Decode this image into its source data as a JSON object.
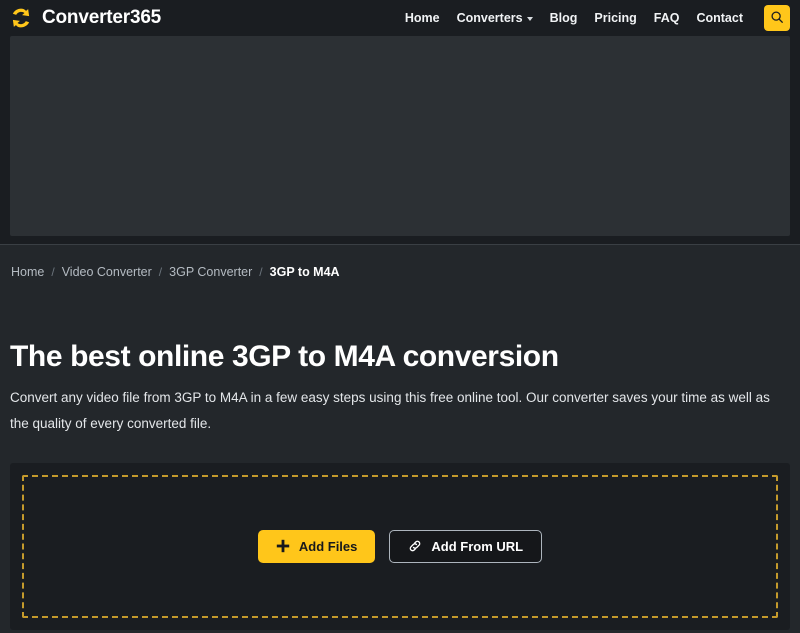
{
  "header": {
    "brand_name": "Converter365",
    "logo_icon": "convert-arrows-icon",
    "nav": [
      {
        "label": "Home",
        "icon": null
      },
      {
        "label": "Converters",
        "icon": "chevron-down-icon"
      },
      {
        "label": "Blog",
        "icon": null
      },
      {
        "label": "Pricing",
        "icon": null
      },
      {
        "label": "FAQ",
        "icon": null
      },
      {
        "label": "Contact",
        "icon": null
      }
    ],
    "search_icon": "search-icon"
  },
  "banner": {
    "placeholder_label": ""
  },
  "breadcrumb": {
    "items": [
      {
        "label": "Home",
        "current": false
      },
      {
        "label": "Video Converter",
        "current": false
      },
      {
        "label": "3GP Converter",
        "current": false
      },
      {
        "label": "3GP to M4A",
        "current": true
      }
    ],
    "separator": "/"
  },
  "main": {
    "title": "The best online 3GP to M4A conversion",
    "description": "Convert any video file from 3GP to M4A in a few easy steps using this free online tool. Our converter saves your time as well as the quality of every converted file."
  },
  "upload": {
    "add_files_label": "Add Files",
    "add_files_icon": "plus-icon",
    "add_url_label": "Add From URL",
    "add_url_icon": "link-icon"
  },
  "colors": {
    "accent": "#ffc61a",
    "header_bg": "#1a1d21",
    "page_bg": "#23272b",
    "banner_bg": "#2c3034",
    "dashed_border": "#c49a2c",
    "text_primary": "#ffffff",
    "text_muted": "#b4bbc2"
  }
}
